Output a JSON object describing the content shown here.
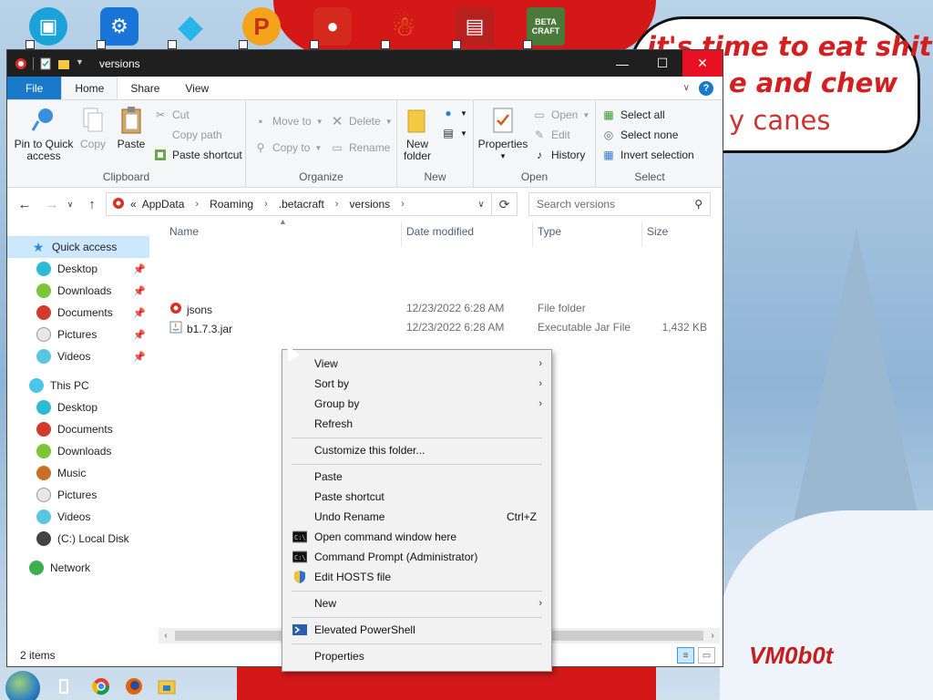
{
  "desktop": {
    "speech_lines": [
      "it's time to eat shit",
      "e and chew",
      "y canes"
    ],
    "signature": "VM0b0t",
    "icons": [
      {
        "name": "computer-icon",
        "glyph": "🖥",
        "color": "#1aa3d8"
      },
      {
        "name": "settings-gear-icon",
        "glyph": "⚙",
        "color": "#1a75d8"
      },
      {
        "name": "diamond-icon",
        "glyph": "◆",
        "color": "#28b6e8"
      },
      {
        "name": "p-app-icon",
        "glyph": "P",
        "color": "#c9301c"
      },
      {
        "name": "angry-bird-icon",
        "glyph": "●",
        "color": "#d42a1e"
      },
      {
        "name": "snowman-app-icon",
        "glyph": "☃",
        "color": "#e07a1e"
      },
      {
        "name": "book-app-icon",
        "glyph": "▤",
        "color": "#b82020"
      },
      {
        "name": "betacraft-icon",
        "glyph": "BETA CRAFT",
        "color": "#4a7a3a"
      }
    ]
  },
  "window": {
    "title": "versions",
    "controls": {
      "minimize": "—",
      "maximize": "☐",
      "close": "✕"
    }
  },
  "ribbon_tabs": [
    "File",
    "Home",
    "Share",
    "View"
  ],
  "ribbon": {
    "clipboard": {
      "label": "Clipboard",
      "pin": "Pin to Quick access",
      "copy": "Copy",
      "paste": "Paste",
      "cut": "Cut",
      "copy_path": "Copy path",
      "paste_shortcut": "Paste shortcut"
    },
    "organize": {
      "label": "Organize",
      "move_to": "Move to",
      "copy_to": "Copy to",
      "delete": "Delete",
      "rename": "Rename"
    },
    "new": {
      "label": "New",
      "new_folder": "New folder"
    },
    "open": {
      "label": "Open",
      "properties": "Properties",
      "open": "Open",
      "edit": "Edit",
      "history": "History"
    },
    "select": {
      "label": "Select",
      "select_all": "Select all",
      "select_none": "Select none",
      "invert_selection": "Invert selection"
    }
  },
  "address": {
    "prefix": "«",
    "crumbs": [
      "AppData",
      "Roaming",
      ".betacraft",
      "versions"
    ],
    "search_placeholder": "Search versions"
  },
  "nav": {
    "quick_access": "Quick access",
    "quick_items": [
      "Desktop",
      "Downloads",
      "Documents",
      "Pictures",
      "Videos"
    ],
    "this_pc": "This PC",
    "pc_items": [
      "Desktop",
      "Documents",
      "Downloads",
      "Music",
      "Pictures",
      "Videos",
      "(C:) Local Disk"
    ],
    "network": "Network"
  },
  "columns": {
    "name": "Name",
    "date": "Date modified",
    "type": "Type",
    "size": "Size"
  },
  "files": [
    {
      "name": "jsons",
      "date": "12/23/2022 6:28 AM",
      "type": "File folder",
      "size": ""
    },
    {
      "name": "b1.7.3.jar",
      "date": "12/23/2022 6:28 AM",
      "type": "Executable Jar File",
      "size": "1,432 KB"
    }
  ],
  "status": {
    "items": "2 items"
  },
  "context_menu": {
    "view": "View",
    "sort_by": "Sort by",
    "group_by": "Group by",
    "refresh": "Refresh",
    "customize": "Customize this folder...",
    "paste": "Paste",
    "paste_shortcut": "Paste shortcut",
    "undo_rename": "Undo Rename",
    "undo_shortcut": "Ctrl+Z",
    "open_cmd": "Open command window here",
    "cmd_admin": "Command Prompt (Administrator)",
    "edit_hosts": "Edit HOSTS file",
    "new": "New",
    "powershell": "Elevated PowerShell",
    "properties": "Properties"
  },
  "colors": {
    "accent": "#1979ca",
    "close": "#e81123",
    "selection": "#cce8ff"
  }
}
